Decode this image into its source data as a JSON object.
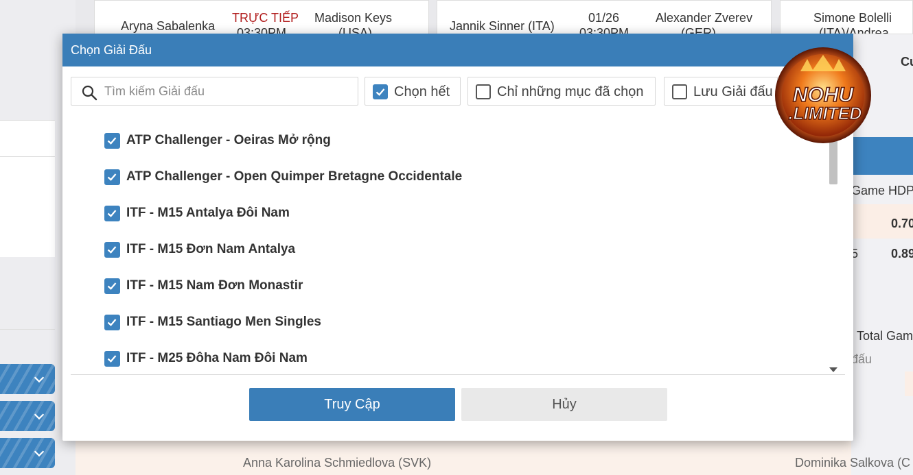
{
  "background": {
    "cards": [
      {
        "player1": "Aryna Sabalenka",
        "status": "TRỰC TIẾP",
        "time": "03:30PM",
        "player2": "Madison Keys",
        "player2_sub": "(USA)"
      },
      {
        "player1": "Jannik Sinner (ITA)",
        "status": "01/26",
        "time": "03:30PM",
        "player2": "Alexander Zverev",
        "player2_sub": "(GER)"
      },
      {
        "player1": "Simone Bolelli",
        "player1_sub": "(ITA)/Andrea..."
      }
    ],
    "right_column": {
      "header": "Cư",
      "game_hdp": "Game HDP",
      "odd1": "0.70",
      "odd2": "0.89",
      "frag": "5",
      "total": "Total Gam",
      "frag2": "đấu"
    },
    "bottom_row": {
      "player_left": "Anna Karolina Schmiedlova (SVK)",
      "player_right": "Dominika Salkova (C"
    },
    "colors": {
      "accent": "#3a7eb8",
      "live": "#b21f1f"
    }
  },
  "modal": {
    "title": "Chọn Giải Đấu",
    "search": {
      "placeholder": "Tìm kiếm Giải đấu",
      "value": "",
      "icon": "search-icon"
    },
    "options": [
      {
        "label": "Chọn hết",
        "checked": true
      },
      {
        "label": "Chỉ những mục đã chọn",
        "checked": false
      },
      {
        "label": "Lưu Giải đấu",
        "checked": false
      }
    ],
    "tournaments": [
      {
        "label": "ATP Challenger - Oeiras Mở rộng",
        "checked": true
      },
      {
        "label": "ATP Challenger - Open Quimper Bretagne Occidentale",
        "checked": true
      },
      {
        "label": "ITF - M15 Antalya Đôi Nam",
        "checked": true
      },
      {
        "label": "ITF - M15 Đơn Nam Antalya",
        "checked": true
      },
      {
        "label": "ITF - M15 Nam Đơn Monastir",
        "checked": true
      },
      {
        "label": "ITF - M15 Santiago Men Singles",
        "checked": true
      },
      {
        "label": "ITF - M25 Đôha Nam Đôi Nam",
        "checked": true
      }
    ],
    "buttons": {
      "confirm": "Truy Cập",
      "cancel": "Hủy"
    }
  },
  "watermark": {
    "line1": "NOHU",
    "line2": ".LIMITED"
  }
}
